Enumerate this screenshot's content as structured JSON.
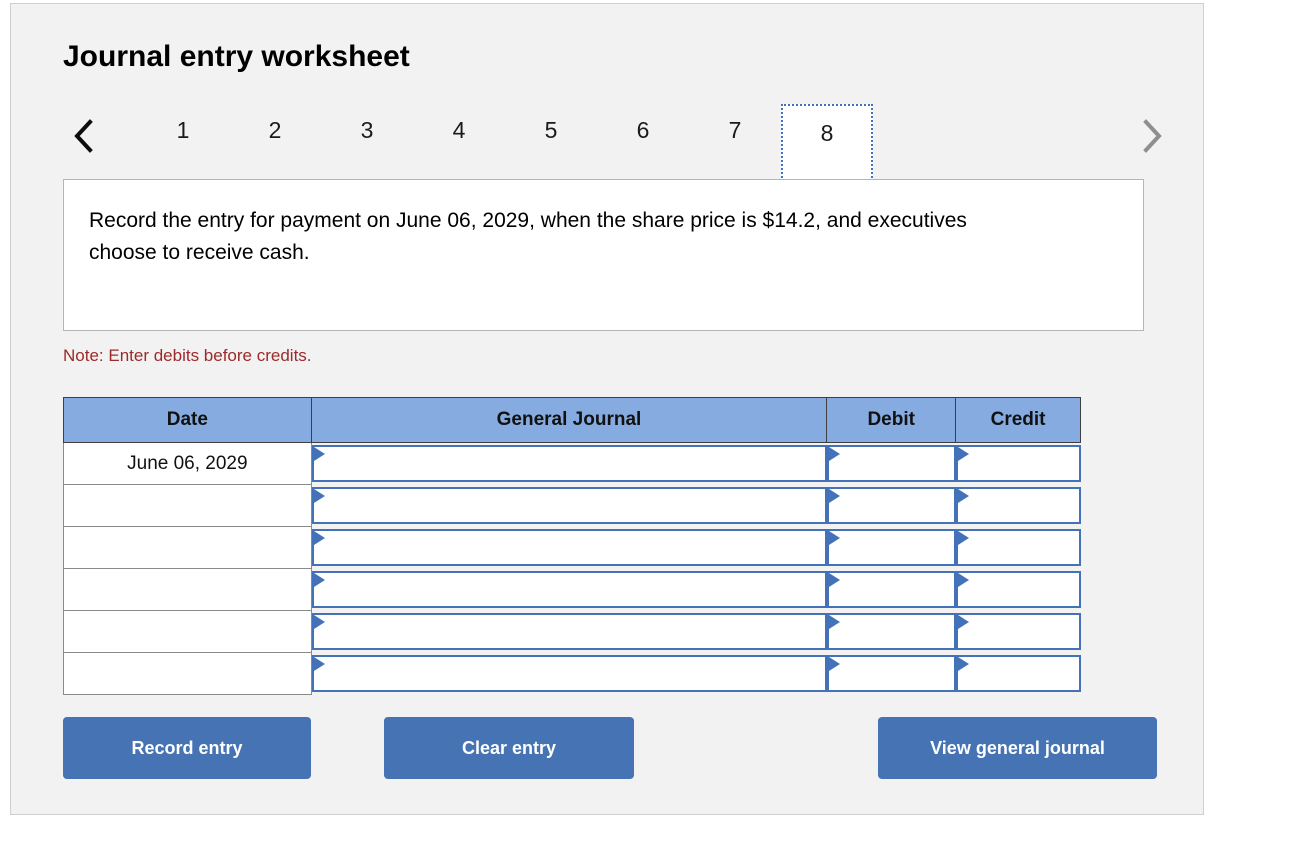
{
  "worksheet": {
    "title": "Journal entry worksheet",
    "note": "Note: Enter debits before credits.",
    "instruction": "Record the entry for payment on June 06, 2029, when the share price is $14.2, and executives choose to receive cash."
  },
  "pager": {
    "prev_icon": "chevron-left-icon",
    "next_icon": "chevron-right-icon",
    "pages": [
      "1",
      "2",
      "3",
      "4",
      "5",
      "6",
      "7",
      "8"
    ],
    "active_page": "8"
  },
  "table": {
    "headers": [
      "Date",
      "General Journal",
      "Debit",
      "Credit"
    ],
    "rows": [
      {
        "date": "June 06, 2029",
        "general_journal": "",
        "debit": "",
        "credit": ""
      },
      {
        "date": "",
        "general_journal": "",
        "debit": "",
        "credit": ""
      },
      {
        "date": "",
        "general_journal": "",
        "debit": "",
        "credit": ""
      },
      {
        "date": "",
        "general_journal": "",
        "debit": "",
        "credit": ""
      },
      {
        "date": "",
        "general_journal": "",
        "debit": "",
        "credit": ""
      },
      {
        "date": "",
        "general_journal": "",
        "debit": "",
        "credit": ""
      }
    ]
  },
  "buttons": {
    "record": "Record entry",
    "clear": "Clear entry",
    "view": "View general journal"
  },
  "colors": {
    "header_blue": "#85abe0",
    "button_blue": "#4573b3",
    "field_border": "#4472b8",
    "note_red": "#9c2a2a",
    "card_bg": "#f2f2f2"
  }
}
